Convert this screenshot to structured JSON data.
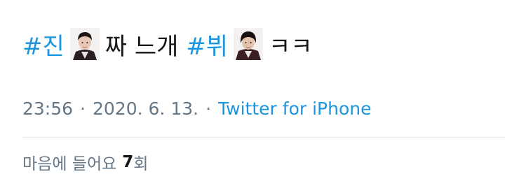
{
  "tweet": {
    "hashtag_1": "#진",
    "avatar_1": "person-1-icon",
    "text_middle": "짜 느개",
    "hashtag_2": "#뷔",
    "avatar_2": "person-2-icon",
    "text_end": "ㅋㅋ"
  },
  "meta": {
    "time": "23:56",
    "separator_1": "·",
    "date": "2020. 6. 13.",
    "separator_2": "·",
    "source": "Twitter for iPhone"
  },
  "likes": {
    "label": "마음에 들어요",
    "count": "7",
    "unit": "회"
  },
  "colors": {
    "link": "#1b95e0",
    "text": "#14171a",
    "muted": "#657786",
    "divider": "#e1e8ed"
  }
}
